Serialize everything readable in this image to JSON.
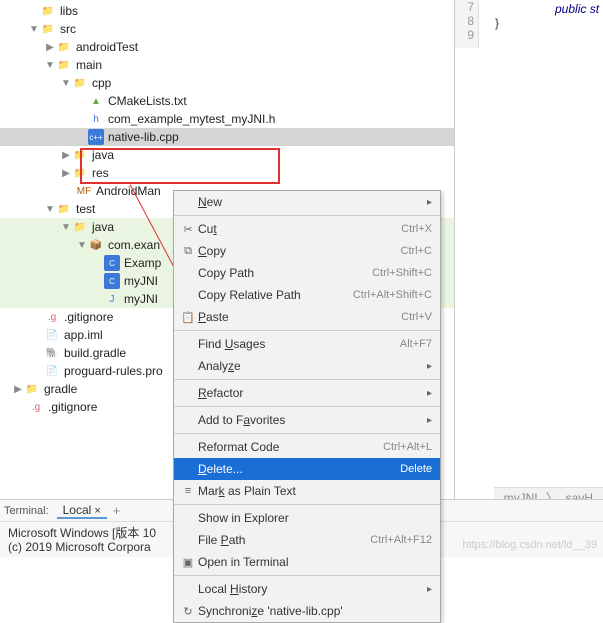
{
  "tree": {
    "libs": "libs",
    "src": "src",
    "androidTest": "androidTest",
    "main": "main",
    "cpp": "cpp",
    "cmakelists": "CMakeLists.txt",
    "jni_h": "com_example_mytest_myJNI.h",
    "nativelib": "native-lib.cpp",
    "java": "java",
    "res": "res",
    "manifest": "AndroidMan",
    "test": "test",
    "test_java": "java",
    "pkg": "com.exan",
    "example_cls": "Examp",
    "myjni_cls": "myJNI",
    "myjni_java": "myJNI",
    "gitignore": ".gitignore",
    "app_iml": "app.iml",
    "build_gradle": "build.gradle",
    "proguard": "proguard-rules.pro",
    "gradle": "gradle",
    "gitignore2": ".gitignore"
  },
  "menu": {
    "new": "New",
    "cut": "Cut",
    "cut_sc": "Ctrl+X",
    "copy": "Copy",
    "copy_sc": "Ctrl+C",
    "copy_path": "Copy Path",
    "copy_path_sc": "Ctrl+Shift+C",
    "copy_rel": "Copy Relative Path",
    "copy_rel_sc": "Ctrl+Alt+Shift+C",
    "paste": "Paste",
    "paste_sc": "Ctrl+V",
    "find_usages": "Find Usages",
    "find_usages_sc": "Alt+F7",
    "analyze": "Analyze",
    "refactor": "Refactor",
    "favorites": "Add to Favorites",
    "reformat": "Reformat Code",
    "reformat_sc": "Ctrl+Alt+L",
    "delete": "Delete...",
    "delete_sc": "Delete",
    "mark_plain": "Mark as Plain Text",
    "show_explorer": "Show in Explorer",
    "file_path": "File Path",
    "file_path_sc": "Ctrl+Alt+F12",
    "open_terminal": "Open in Terminal",
    "local_history": "Local History",
    "synchronize": "Synchronize 'native-lib.cpp'"
  },
  "editor": {
    "line7": "7",
    "line8": "8",
    "line9": "9",
    "code7": "public st",
    "code8": "}",
    "bc1": "myJNI",
    "bc2": "sayH"
  },
  "terminal": {
    "label": "Terminal:",
    "tab": "Local",
    "line1": "Microsoft Windows [版本 10",
    "line2": "(c) 2019 Microsoft Corpora"
  },
  "watermark": "https://blog.csdn.net/ld__39"
}
